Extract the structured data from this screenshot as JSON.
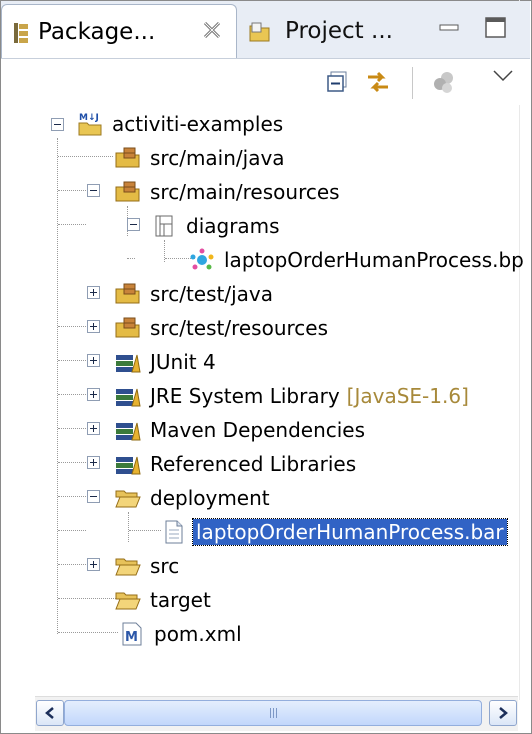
{
  "tabs": [
    {
      "label": "Package...",
      "icon": "package-explorer-icon",
      "active": true
    },
    {
      "label": "Project ...",
      "icon": "project-explorer-icon",
      "active": false
    }
  ],
  "toolbar": {
    "buttons": [
      "collapse-all-icon",
      "link-with-editor-icon",
      "view-menu-icon"
    ]
  },
  "tree": [
    {
      "id": "project",
      "label": "activiti-examples",
      "icon": "maven-project-icon"
    },
    {
      "id": "src-main-java",
      "label": "src/main/java",
      "icon": "source-folder-icon"
    },
    {
      "id": "src-main-resources",
      "label": "src/main/resources",
      "icon": "source-folder-icon"
    },
    {
      "id": "diagrams",
      "label": "diagrams",
      "icon": "package-icon"
    },
    {
      "id": "bp-file",
      "label": "laptopOrderHumanProcess.bp",
      "icon": "bpmn-diagram-icon"
    },
    {
      "id": "src-test-java",
      "label": "src/test/java",
      "icon": "source-folder-icon"
    },
    {
      "id": "src-test-resources",
      "label": "src/test/resources",
      "icon": "source-folder-icon"
    },
    {
      "id": "junit",
      "label": "JUnit 4",
      "icon": "library-icon"
    },
    {
      "id": "jre",
      "label": "JRE System Library",
      "decoration": "[JavaSE-1.6]",
      "icon": "library-icon"
    },
    {
      "id": "maven-deps",
      "label": "Maven Dependencies",
      "icon": "library-icon"
    },
    {
      "id": "ref-libs",
      "label": "Referenced Libraries",
      "icon": "library-icon"
    },
    {
      "id": "deployment",
      "label": "deployment",
      "icon": "folder-icon"
    },
    {
      "id": "bar-file",
      "label": "laptopOrderHumanProcess.bar",
      "icon": "file-icon",
      "selected": true
    },
    {
      "id": "src",
      "label": "src",
      "icon": "folder-icon"
    },
    {
      "id": "target",
      "label": "target",
      "icon": "folder-icon"
    },
    {
      "id": "pom",
      "label": "pom.xml",
      "icon": "maven-pom-icon"
    }
  ],
  "scrollbar": {
    "grip": "III"
  },
  "colors": {
    "selection": "#3163c5",
    "tabbar": "#e8edf5",
    "decoration": "#a7893a"
  }
}
